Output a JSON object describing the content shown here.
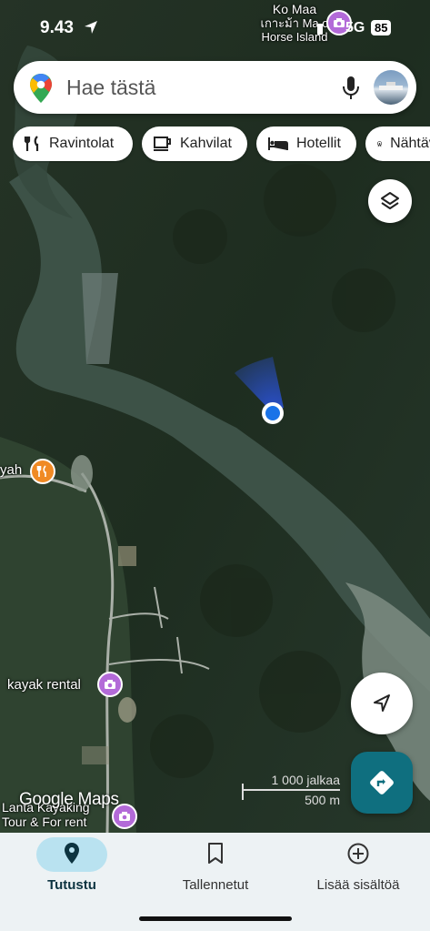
{
  "status_bar": {
    "time": "9.43",
    "network": "5G",
    "battery": "85"
  },
  "search": {
    "placeholder": "Hae tästä"
  },
  "chips": [
    {
      "label": "Ravintolat",
      "icon": "fork-knife-icon"
    },
    {
      "label": "Kahvilat",
      "icon": "coffee-cup-icon"
    },
    {
      "label": "Hotellit",
      "icon": "bed-icon"
    },
    {
      "label": "Nähtävyydet",
      "icon": "ferris-wheel-icon"
    }
  ],
  "map": {
    "place_top": {
      "line1": "Ko Maa",
      "line2": "เกาะม้า Ma o",
      "line3": "Horse Island"
    },
    "place_left": "yah",
    "kayak_rental": "kayak rental",
    "lanta_line1": "Lanta Kayaking",
    "lanta_line2": "Tour & For rent",
    "scale_ft": "1 000 jalkaa",
    "scale_m": "500 m",
    "logo": "Google Maps"
  },
  "nav": {
    "tabs": [
      {
        "label": "Tutustu",
        "icon": "location-pin-icon",
        "active": true
      },
      {
        "label": "Tallennetut",
        "icon": "bookmark-icon",
        "active": false
      },
      {
        "label": "Lisää sisältöä",
        "icon": "add-circle-icon",
        "active": false
      }
    ]
  },
  "colors": {
    "accent": "#0f6f7f",
    "active_tab": "#b9e2f0",
    "poi_purple": "#b36ad8",
    "poi_food": "#f08a24",
    "location_blue": "#1a73e8"
  }
}
